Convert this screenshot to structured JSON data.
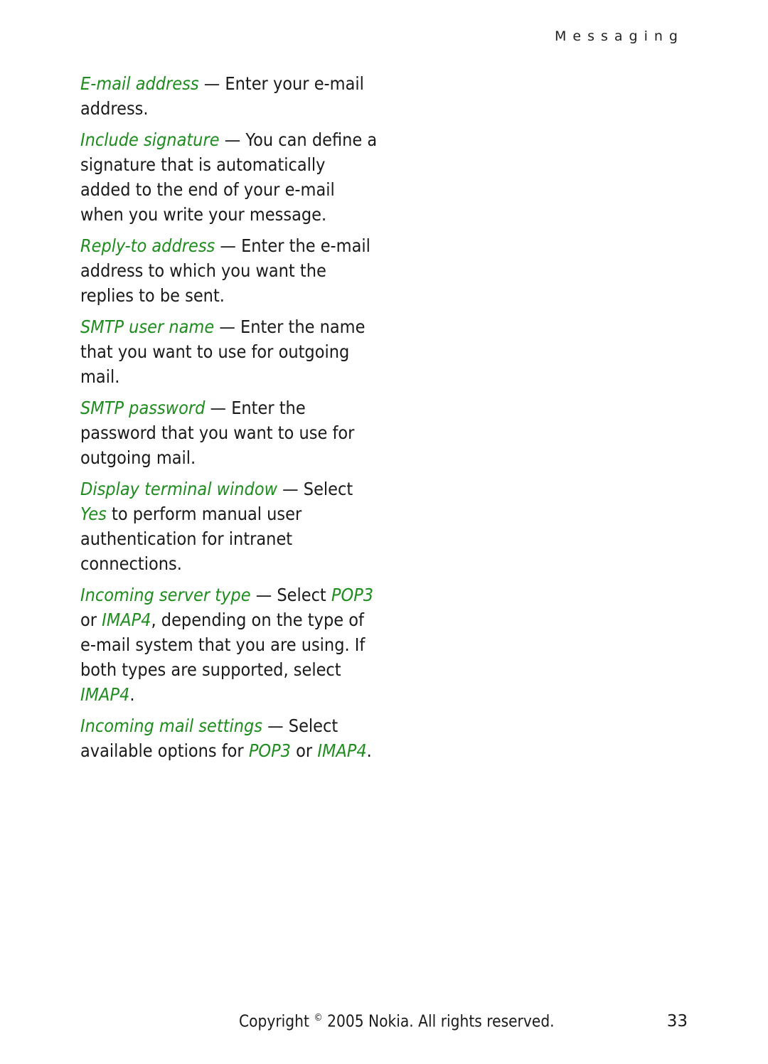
{
  "header": {
    "section_title": "Messaging"
  },
  "paragraphs": [
    {
      "segments": [
        {
          "t": "E-mail address",
          "g": true
        },
        {
          "t": " — Enter your e-mail address.",
          "g": false
        }
      ]
    },
    {
      "segments": [
        {
          "t": "Include signature",
          "g": true
        },
        {
          "t": " — You can define a signature that is automatically added to the end of your e-mail when you write your message.",
          "g": false
        }
      ]
    },
    {
      "segments": [
        {
          "t": "Reply-to address",
          "g": true
        },
        {
          "t": " — Enter the e-mail address to which you want the replies to be sent.",
          "g": false
        }
      ]
    },
    {
      "segments": [
        {
          "t": "SMTP user name",
          "g": true
        },
        {
          "t": " — Enter the name that you want to use for outgoing mail.",
          "g": false
        }
      ]
    },
    {
      "segments": [
        {
          "t": "SMTP password",
          "g": true
        },
        {
          "t": " — Enter the password that you want to use for outgoing mail.",
          "g": false
        }
      ]
    },
    {
      "segments": [
        {
          "t": "Display terminal window",
          "g": true
        },
        {
          "t": " — Select ",
          "g": false
        },
        {
          "t": "Yes",
          "g": true
        },
        {
          "t": " to perform manual user authentication for intranet connections.",
          "g": false
        }
      ]
    },
    {
      "segments": [
        {
          "t": "Incoming server type",
          "g": true
        },
        {
          "t": " — Select ",
          "g": false
        },
        {
          "t": "POP3",
          "g": true
        },
        {
          "t": " or ",
          "g": false
        },
        {
          "t": "IMAP4",
          "g": true
        },
        {
          "t": ", depending on the type of e-mail system that you are using. If both types are supported, select ",
          "g": false
        },
        {
          "t": "IMAP4",
          "g": true
        },
        {
          "t": ".",
          "g": false
        }
      ]
    },
    {
      "segments": [
        {
          "t": "Incoming mail settings",
          "g": true
        },
        {
          "t": " — Select available options for ",
          "g": false
        },
        {
          "t": "POP3",
          "g": true
        },
        {
          "t": " or ",
          "g": false
        },
        {
          "t": "IMAP4",
          "g": true
        },
        {
          "t": ".",
          "g": false
        }
      ]
    }
  ],
  "footer": {
    "copyright_prefix": "Copyright",
    "copyright_symbol": "©",
    "copyright_suffix": "2005 Nokia. All rights reserved.",
    "page_number": "33"
  },
  "colors": {
    "term": "#1e8c1e",
    "text": "#1a1a1a"
  }
}
